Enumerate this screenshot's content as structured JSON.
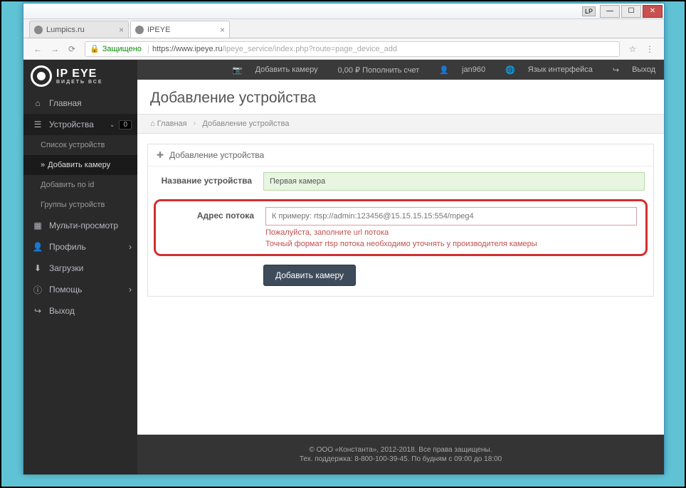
{
  "titlebar": {
    "lp": "LP"
  },
  "tabs": [
    {
      "label": "Lumpics.ru"
    },
    {
      "label": "IPEYE"
    }
  ],
  "addressbar": {
    "secure": "Защищено",
    "host": "https://www.ipeye.ru",
    "path": "/ipeye_service/index.php?route=page_device_add"
  },
  "logo": {
    "brand": "IP EYE",
    "tagline": "ВИДЕТЬ ВСЕ"
  },
  "topbar": {
    "add_camera": "Добавить камеру",
    "balance": "0,00 ₽ Пополнить счет",
    "user": "jan960",
    "lang": "Язык интерфейса",
    "logout": "Выход"
  },
  "sidebar": {
    "home": "Главная",
    "devices": "Устройства",
    "devices_badge": "0",
    "device_list": "Список устройств",
    "add_camera": "Добавить камеру",
    "add_by_id": "Добавить по id",
    "device_groups": "Группы устройств",
    "multiview": "Мульти-просмотр",
    "profile": "Профиль",
    "downloads": "Загрузки",
    "help": "Помощь",
    "logout": "Выход"
  },
  "page": {
    "title": "Добавление устройства",
    "breadcrumb_home": "Главная",
    "breadcrumb_current": "Добавление устройства",
    "panel_title": "Добавление устройства"
  },
  "form": {
    "name_label": "Название устройства",
    "name_value": "Первая камера",
    "stream_label": "Адрес потока",
    "stream_placeholder": "К примеру: rtsp://admin:123456@15.15.15.15:554/mpeg4",
    "error1": "Пожалуйста, заполните url потока",
    "error2": "Точный формат rtsp потока необходимо уточнять у производителя камеры",
    "submit": "Добавить камеру"
  },
  "footer": {
    "line1": "© ООО «Константа», 2012-2018. Все права защищены.",
    "line2": "Тех. поддержка: 8-800-100-39-45. По будням с 09:00 до 18:00"
  }
}
